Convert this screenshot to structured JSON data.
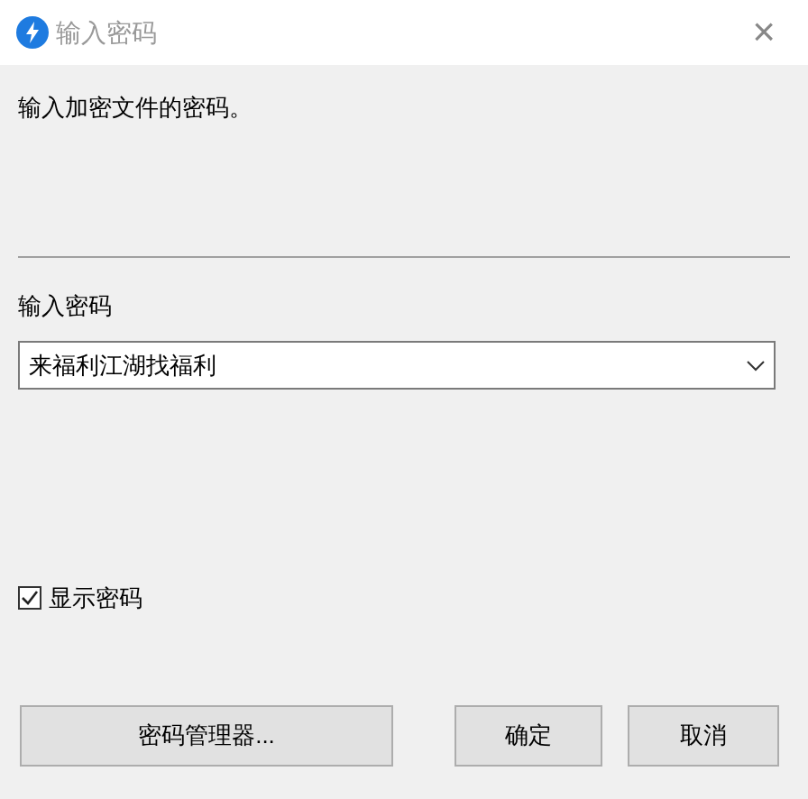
{
  "window": {
    "title": "输入密码",
    "close": "×"
  },
  "message": "输入加密文件的密码。",
  "password": {
    "label": "输入密码",
    "value": "来福利江湖找福利"
  },
  "show_password": {
    "label": "显示密码",
    "checked": true
  },
  "buttons": [
    "密码管理器...",
    "确定",
    "取消"
  ]
}
